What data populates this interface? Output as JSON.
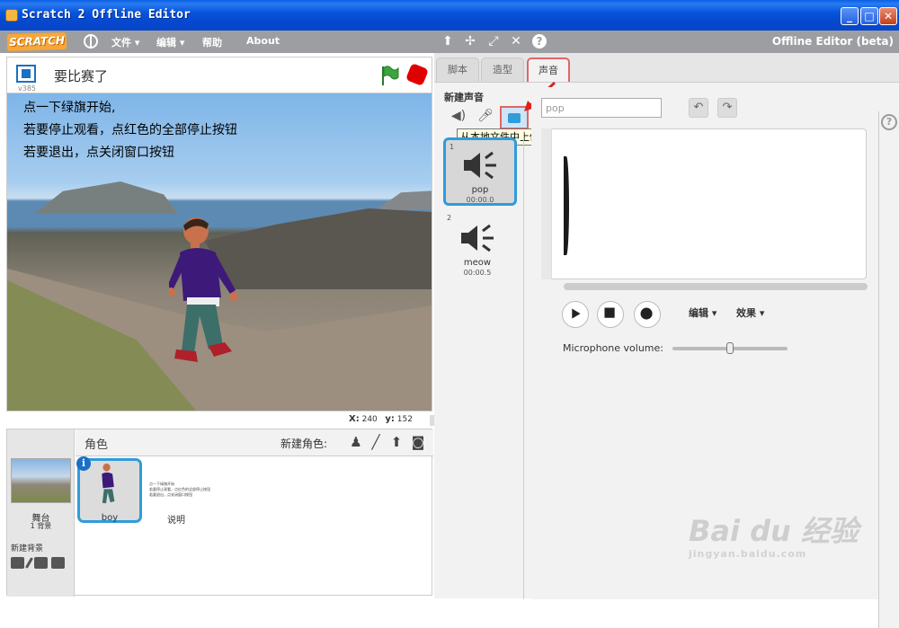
{
  "window": {
    "title": "Scratch 2 Offline Editor",
    "minimize": "_",
    "maximize": "□",
    "close": "✕"
  },
  "menubar": {
    "logo": "SCRATCH",
    "file": "文件 ▾",
    "edit": "编辑 ▾",
    "help": "帮助",
    "about": "About",
    "tools": [
      "stamp-icon",
      "cut-icon",
      "grow-icon",
      "shrink-icon",
      "help-icon"
    ],
    "offline_label": "Offline Editor (beta)"
  },
  "stage": {
    "version": "v385",
    "project_title": "要比赛了",
    "instructions": [
      "点一下绿旗开始,",
      "若要停止观看，点红色的全部停止按钮",
      "若要退出，点关闭窗口按钮"
    ],
    "x_label": "X:",
    "x_value": "240",
    "y_label": "y:",
    "y_value": "152"
  },
  "sprites": {
    "header_label": "角色",
    "new_sprite_label": "新建角色:",
    "stage_label": "舞台",
    "stage_backdrops": "1 背景",
    "new_backdrop": "新建背景",
    "items": [
      {
        "name": "boy"
      },
      {
        "name": "说明"
      }
    ],
    "note_preview": [
      "点一下绿旗开始",
      "若要停止观看，点红色的全部停止按钮",
      "若要退出，点关闭窗口按钮"
    ]
  },
  "tabs": {
    "scripts": "脚本",
    "costumes": "造型",
    "sounds": "声音"
  },
  "sounds": {
    "new_sound_label": "新建声音",
    "tooltip": "从本地文件中上传声音",
    "items": [
      {
        "num": "1",
        "name": "pop",
        "duration": "00:00.0"
      },
      {
        "num": "2",
        "name": "meow",
        "duration": "00:00.5"
      }
    ],
    "name_field_value": "pop",
    "edit_menu": "编辑 ▾",
    "effects_menu": "效果 ▾",
    "mic_volume_label": "Microphone volume:",
    "mic_volume": 0.5
  },
  "watermark": {
    "brand": "Bai du 经验",
    "url": "jingyan.baidu.com"
  }
}
